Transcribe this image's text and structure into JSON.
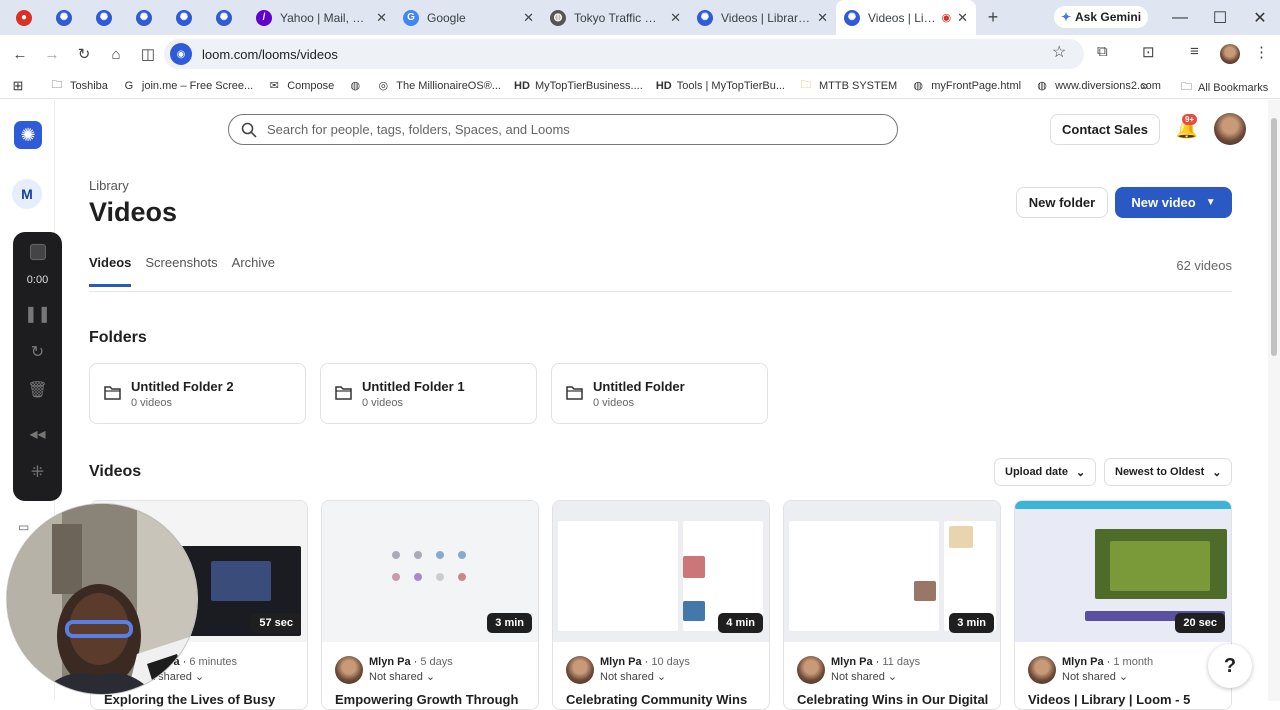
{
  "browser": {
    "tabs": [
      {
        "title": "",
        "icon": "recording-dot-icon",
        "color": "#d93025"
      },
      {
        "title": "",
        "icon": "loom-icon",
        "color": "#2f5bd8"
      },
      {
        "title": "",
        "icon": "loom-icon",
        "color": "#2f5bd8"
      },
      {
        "title": "",
        "icon": "loom-icon",
        "color": "#2f5bd8"
      },
      {
        "title": "",
        "icon": "loom-icon",
        "color": "#2f5bd8"
      },
      {
        "title": "",
        "icon": "loom-icon",
        "color": "#2f5bd8"
      },
      {
        "title": "Yahoo | Mail, Weat",
        "icon": "yahoo-icon",
        "color": "#6001d2"
      },
      {
        "title": "Google",
        "icon": "google-icon",
        "color": "#4285f4"
      },
      {
        "title": "Tokyo Traffic Video",
        "icon": "globe-icon",
        "color": "#555555"
      },
      {
        "title": "Videos | Library | L",
        "icon": "loom-icon",
        "color": "#2f5bd8"
      },
      {
        "title": "Videos | Librar",
        "icon": "loom-icon",
        "color": "#2f5bd8",
        "active": true
      }
    ],
    "ask_gemini": "Ask Gemini",
    "url": "loom.com/looms/videos",
    "bookmarks": [
      {
        "label": "Toshiba",
        "icon": "folder-icon"
      },
      {
        "label": "join.me – Free Scree...",
        "icon": "google-g-icon"
      },
      {
        "label": "Compose",
        "icon": "mail-icon"
      },
      {
        "label": "",
        "icon": "globe-icon"
      },
      {
        "label": "The MillionaireOS®...",
        "icon": "millionaire-icon"
      },
      {
        "label": "MyTopTierBusiness....",
        "icon": "hd-icon"
      },
      {
        "label": "Tools | MyTopTierBu...",
        "icon": "hd-icon"
      },
      {
        "label": "MTTB SYSTEM",
        "icon": "folder-icon"
      },
      {
        "label": "myFrontPage.html",
        "icon": "globe-icon"
      },
      {
        "label": "www.diversions2.com",
        "icon": "globe-icon"
      }
    ],
    "more_bookmarks": "»",
    "all_bookmarks": "All Bookmarks"
  },
  "recorder": {
    "time": "0:00"
  },
  "workspace_initial": "M",
  "search": {
    "placeholder": "Search for people, tags, folders, Spaces, and Looms"
  },
  "header": {
    "contact_sales": "Contact Sales",
    "notifications_badge": "9+"
  },
  "page": {
    "breadcrumb": "Library",
    "title": "Videos",
    "new_folder": "New folder",
    "new_video": "New video",
    "tabs": [
      "Videos",
      "Screenshots",
      "Archive"
    ],
    "active_tab": "Videos",
    "video_count": "62 videos"
  },
  "folders_section": {
    "heading": "Folders",
    "items": [
      {
        "name": "Untitled Folder 2",
        "count": "0 videos"
      },
      {
        "name": "Untitled Folder 1",
        "count": "0 videos"
      },
      {
        "name": "Untitled Folder",
        "count": "0 videos"
      }
    ]
  },
  "videos_section": {
    "heading": "Videos",
    "sort_field": "Upload date",
    "sort_order": "Newest to Oldest",
    "items": [
      {
        "duration": "57 sec",
        "author": "Mlyn Pa",
        "age": "6 minutes",
        "share": "Not shared",
        "title": "Exploring the Lives of Busy"
      },
      {
        "duration": "3 min",
        "author": "Mlyn Pa",
        "age": "5 days",
        "share": "Not shared",
        "title": "Empowering Growth Through"
      },
      {
        "duration": "4 min",
        "author": "Mlyn Pa",
        "age": "10 days",
        "share": "Not shared",
        "title": "Celebrating Community Wins"
      },
      {
        "duration": "3 min",
        "author": "Mlyn Pa",
        "age": "11 days",
        "share": "Not shared",
        "title": "Celebrating Wins in Our Digital"
      },
      {
        "duration": "20 sec",
        "author": "Mlyn Pa",
        "age": "1 month",
        "share": "Not shared",
        "title": "Videos | Library | Loom - 5"
      }
    ]
  },
  "help_label": "?"
}
